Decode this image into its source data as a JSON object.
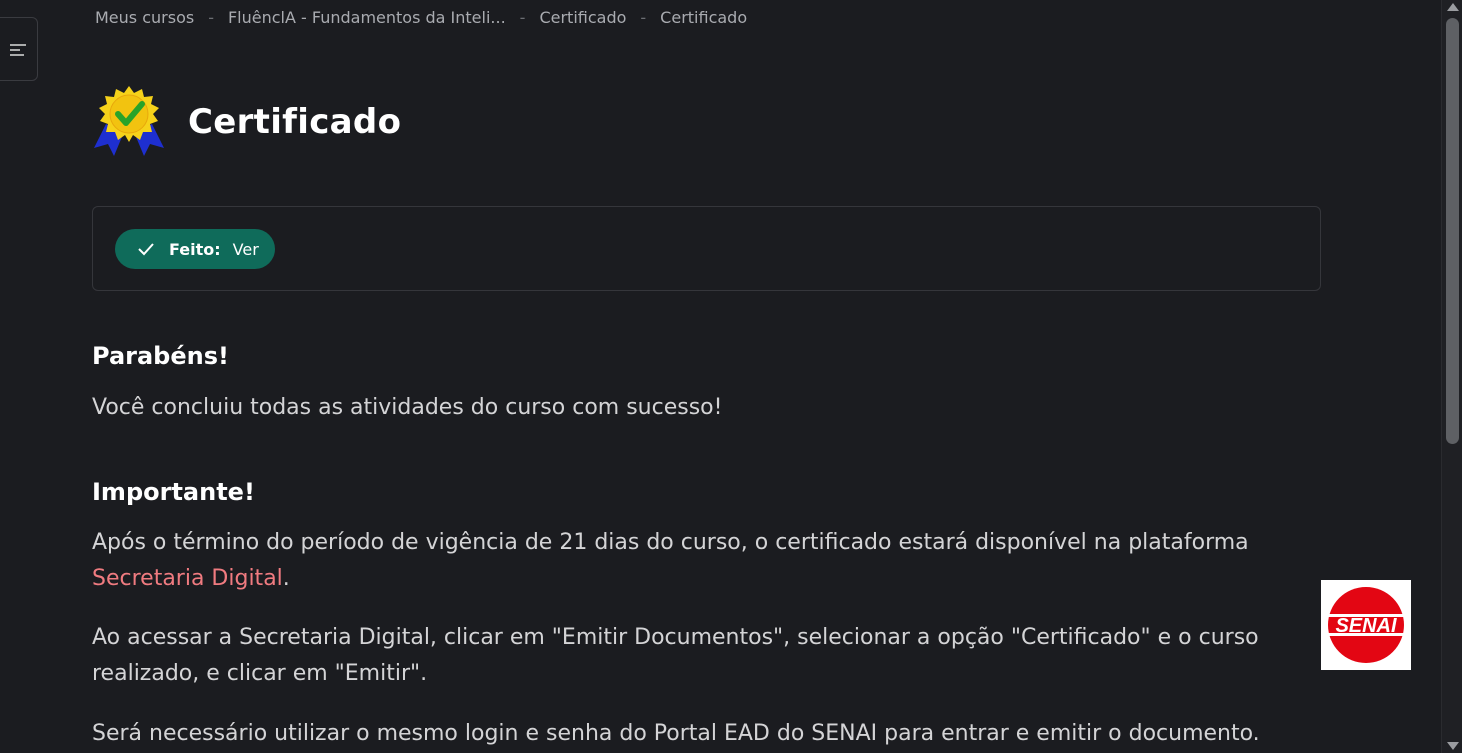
{
  "breadcrumb": {
    "items": [
      "Meus cursos",
      "FluênclA - Fundamentos da Inteli...",
      "Certificado",
      "Certificado"
    ],
    "separator": "-"
  },
  "page": {
    "title": "Certificado",
    "icon": "certificate-award-icon"
  },
  "completion": {
    "label": "Feito:",
    "value": "Ver",
    "color": "#0f6b5a"
  },
  "content": {
    "parabens_heading": "Parabéns!",
    "parabens_text": "Você concluiu todas as atividades do curso com sucesso!",
    "importante_heading": "Importante!",
    "apos_text": "Após o término do período de vigência de 21 dias do curso, o certificado estará disponível na plataforma",
    "apos_link": "Secretaria Digital",
    "apos_end": ".",
    "acessar_text": "Ao acessar a Secretaria Digital, clicar em \"Emitir Documentos\", selecionar a opção \"Certificado\" e o curso realizado, e clicar em \"Emitir\".",
    "sera_text": "Será necessário utilizar o mesmo login e senha do Portal EAD do SENAI para entrar e emitir o documento.",
    "link_color": "#f07b80"
  },
  "logo": {
    "text": "SENAI",
    "color": "#e30613"
  }
}
